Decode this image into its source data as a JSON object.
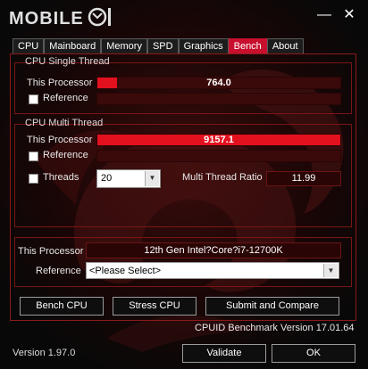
{
  "app": {
    "logo_text": "MOBILE"
  },
  "window_controls": {
    "minimize": "—",
    "close": "✕"
  },
  "tabs": [
    {
      "label": "CPU"
    },
    {
      "label": "Mainboard"
    },
    {
      "label": "Memory"
    },
    {
      "label": "SPD"
    },
    {
      "label": "Graphics"
    },
    {
      "label": "Bench",
      "active": true
    },
    {
      "label": "About"
    }
  ],
  "single_thread": {
    "title": "CPU Single Thread",
    "this_processor_label": "This Processor",
    "this_processor_value": "764.0",
    "this_processor_fraction": 0.082,
    "reference_label": "Reference"
  },
  "multi_thread": {
    "title": "CPU Multi Thread",
    "this_processor_label": "This Processor",
    "this_processor_value": "9157.1",
    "this_processor_fraction": 1.0,
    "reference_label": "Reference",
    "threads_label": "Threads",
    "threads_value": "20",
    "ratio_label": "Multi Thread Ratio",
    "ratio_value": "11.99"
  },
  "info": {
    "this_processor_label": "This Processor",
    "this_processor_value": "12th Gen Intel?Core?i7-12700K",
    "reference_label": "Reference",
    "reference_select": "<Please Select>"
  },
  "buttons": {
    "bench": "Bench CPU",
    "stress": "Stress CPU",
    "submit": "Submit and Compare"
  },
  "benchmark_version": "CPUID Benchmark Version 17.01.64",
  "footer": {
    "version": "Version 1.97.0",
    "validate": "Validate",
    "ok": "OK"
  },
  "colors": {
    "accent": "#e3101e",
    "tab_active": "#c8102e",
    "bar_bg": "#3a0a0a"
  }
}
